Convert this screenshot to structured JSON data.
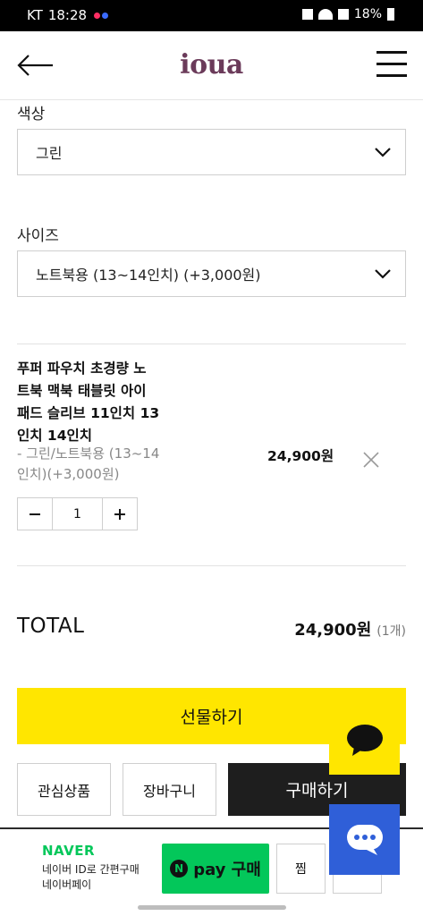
{
  "status_bar": {
    "carrier": "KT",
    "time": "18:28",
    "battery": "18%"
  },
  "header": {
    "logo": "ioua"
  },
  "options": {
    "color_label": "색상",
    "color_value": "그린",
    "size_label": "사이즈",
    "size_value": "노트북용 (13~14인치) (+3,000원)"
  },
  "cart_item": {
    "name_lines": [
      "푸퍼 파우치 초경량 노",
      "트북 맥북 태블릿 아이",
      "패드 슬리브 11인치 13",
      "인치 14인치"
    ],
    "option_lines": [
      "- 그린/노트북용 (13~14",
      "인치)(+3,000원)"
    ],
    "price": "24,900원",
    "quantity": "1"
  },
  "total": {
    "label": "TOTAL",
    "price": "24,900원",
    "count": "(1개)"
  },
  "buttons": {
    "gift": "선물하기",
    "wishlist": "관심상품",
    "cart": "장바구니",
    "buy": "구매하기"
  },
  "naver_pay": {
    "brand": "NAVER",
    "desc_line1": "네이버 ID로 간편구매",
    "desc_line2": "네이버페이",
    "pay_label": "pay 구매",
    "jjim": "찜"
  },
  "colors": {
    "gift_yellow": "#ffe600",
    "buy_dark": "#1e1e1e",
    "naver_green": "#03c75a",
    "chat_blue": "#2f5fd8",
    "logo_purple": "#6b3b5a"
  }
}
